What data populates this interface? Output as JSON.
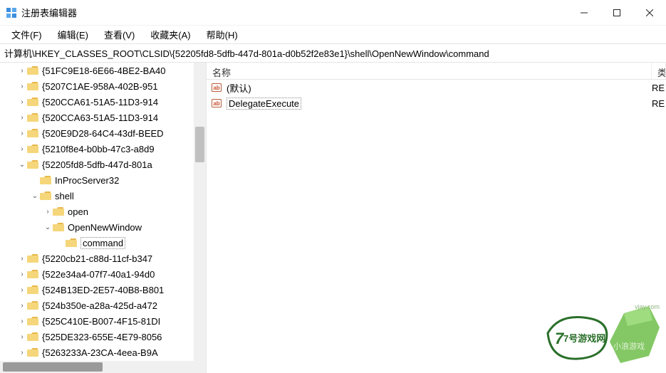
{
  "titlebar": {
    "title": "注册表编辑器"
  },
  "menubar": {
    "items": [
      "文件(F)",
      "编辑(E)",
      "查看(V)",
      "收藏夹(A)",
      "帮助(H)"
    ]
  },
  "addressbar": {
    "path": "计算机\\HKEY_CLASSES_ROOT\\CLSID\\{52205fd8-5dfb-447d-801a-d0b52f2e83e1}\\shell\\OpenNewWindow\\command"
  },
  "tree": {
    "nodes": [
      {
        "indent": 1,
        "expander": "›",
        "label": "{51FC9E18-6E66-4BE2-BA40"
      },
      {
        "indent": 1,
        "expander": "›",
        "label": "{5207C1AE-958A-402B-951"
      },
      {
        "indent": 1,
        "expander": "›",
        "label": "{520CCA61-51A5-11D3-914"
      },
      {
        "indent": 1,
        "expander": "›",
        "label": "{520CCA63-51A5-11D3-914"
      },
      {
        "indent": 1,
        "expander": "›",
        "label": "{520E9D28-64C4-43df-BEED"
      },
      {
        "indent": 1,
        "expander": "›",
        "label": "{5210f8e4-b0bb-47c3-a8d9"
      },
      {
        "indent": 1,
        "expander": "⌄",
        "label": "{52205fd8-5dfb-447d-801a"
      },
      {
        "indent": 2,
        "expander": "",
        "label": "InProcServer32"
      },
      {
        "indent": 2,
        "expander": "⌄",
        "label": "shell"
      },
      {
        "indent": 3,
        "expander": "›",
        "label": "open"
      },
      {
        "indent": 3,
        "expander": "⌄",
        "label": "OpenNewWindow"
      },
      {
        "indent": 4,
        "expander": "",
        "label": "command",
        "selected": true
      },
      {
        "indent": 1,
        "expander": "›",
        "label": "{5220cb21-c88d-11cf-b347"
      },
      {
        "indent": 1,
        "expander": "›",
        "label": "{522e34a4-07f7-40a1-94d0"
      },
      {
        "indent": 1,
        "expander": "›",
        "label": "{524B13ED-2E57-40B8-B801"
      },
      {
        "indent": 1,
        "expander": "›",
        "label": "{524b350e-a28a-425d-a472"
      },
      {
        "indent": 1,
        "expander": "›",
        "label": "{525C410E-B007-4F15-81DI"
      },
      {
        "indent": 1,
        "expander": "›",
        "label": "{525DE323-655E-4E79-8056"
      },
      {
        "indent": 1,
        "expander": "›",
        "label": "{5263233A-23CA-4eea-B9A"
      }
    ]
  },
  "list": {
    "columns": {
      "name": "名称",
      "type": "类"
    },
    "rows": [
      {
        "name": "(默认)",
        "type": "RE",
        "selected": false
      },
      {
        "name": "DelegateExecute",
        "type": "RE",
        "selected": true
      }
    ]
  },
  "watermark": {
    "line1": "7号游戏网",
    "line2": "小浪游戏",
    "url": "vjay.com"
  }
}
